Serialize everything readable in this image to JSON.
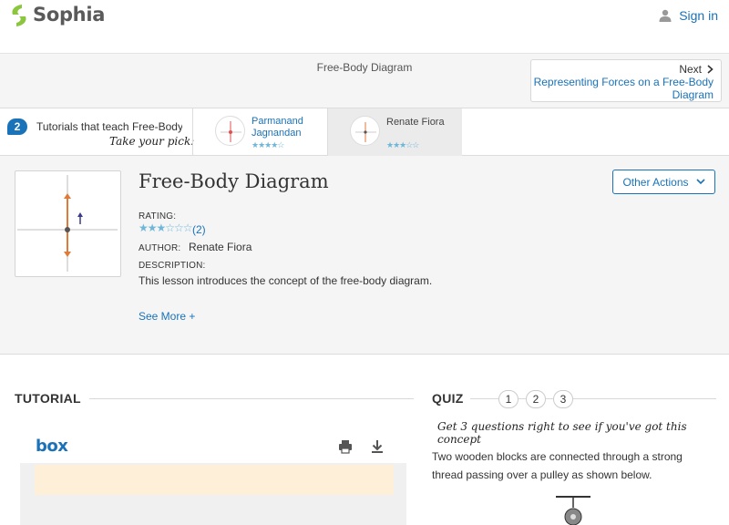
{
  "header": {
    "brand": "Sophia",
    "signin_label": "Sign in"
  },
  "titlebar": {
    "title": "Free-Body Diagram",
    "next_label": "Next",
    "next_link_line1": "Representing Forces on a Free-Body",
    "next_link_line2": "Diagram"
  },
  "tutorials": {
    "count": "2",
    "label": "Tutorials that teach Free-Body Diagram",
    "pick_label": "Take your pick:",
    "tutors": [
      {
        "name_line1": "Parmanand",
        "name_line2": "Jagnandan",
        "stars": "★★★★☆"
      },
      {
        "name_line1": "Renate Fiora",
        "name_line2": "",
        "stars": "★★★☆☆"
      }
    ]
  },
  "lesson": {
    "title": "Free-Body Diagram",
    "other_actions_label": "Other Actions",
    "rating_label": "RATING:",
    "rating_stars": "★★★☆☆☆",
    "rating_count": "(2)",
    "author_label": "AUTHOR:",
    "author_name": "Renate Fiora",
    "description_label": "DESCRIPTION:",
    "description": "This lesson introduces the concept of the free-body diagram.",
    "see_more_label": "See More +"
  },
  "tutorial_section": {
    "heading": "TUTORIAL",
    "viewer_brand": "box"
  },
  "quiz": {
    "heading": "QUIZ",
    "questions": [
      "1",
      "2",
      "3"
    ],
    "tagline": "Get 3 questions right to see if you've got this concept",
    "question_text": "Two wooden blocks are connected through a strong thread passing over a pulley as shown below."
  },
  "colors": {
    "accent": "#1a72b8",
    "brand_green": "#8cc63f",
    "star": "#6fb7d8"
  }
}
